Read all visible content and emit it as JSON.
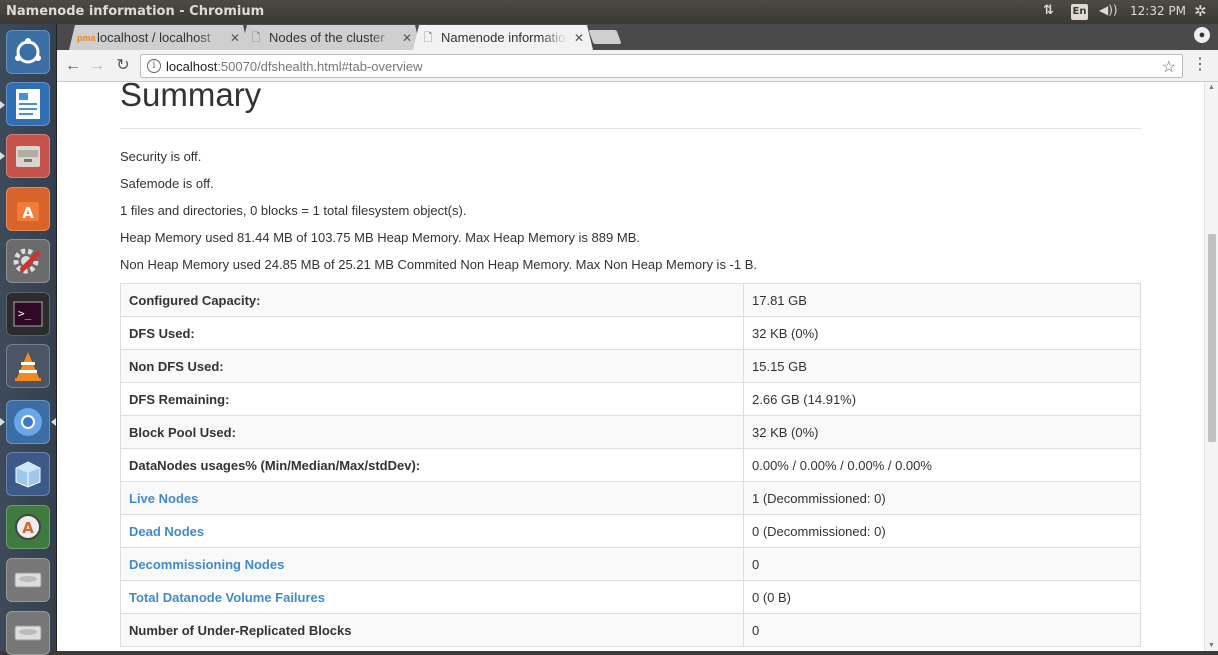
{
  "system": {
    "window_title": "Namenode information - Chromium",
    "lang": "En",
    "time": "12:32 PM"
  },
  "launcher": {
    "apps": [
      "ubuntu-dash-icon",
      "writer-icon",
      "files-icon",
      "software-center-icon",
      "system-settings-icon",
      "terminal-icon",
      "vlc-icon",
      "chromium-icon",
      "virtualbox-icon",
      "software-updater-icon",
      "drive-icon",
      "drive-icon",
      "drive-icon"
    ]
  },
  "browser": {
    "tabs": [
      {
        "title": "localhost / localhost",
        "active": false
      },
      {
        "title": "Nodes of the cluster",
        "active": false
      },
      {
        "title": "Namenode information",
        "active": true
      }
    ],
    "url_host": "localhost",
    "url_rest": ":50070/dfshealth.html#tab-overview"
  },
  "page": {
    "title": "Summary",
    "lines": [
      "Security is off.",
      "Safemode is off.",
      "1 files and directories, 0 blocks = 1 total filesystem object(s).",
      "Heap Memory used 81.44 MB of 103.75 MB Heap Memory. Max Heap Memory is 889 MB.",
      "Non Heap Memory used 24.85 MB of 25.21 MB Commited Non Heap Memory. Max Non Heap Memory is -1 B."
    ],
    "rows": [
      {
        "key": "Configured Capacity:",
        "value": "17.81 GB",
        "link": false
      },
      {
        "key": "DFS Used:",
        "value": "32 KB (0%)",
        "link": false
      },
      {
        "key": "Non DFS Used:",
        "value": "15.15 GB",
        "link": false
      },
      {
        "key": "DFS Remaining:",
        "value": "2.66 GB (14.91%)",
        "link": false
      },
      {
        "key": "Block Pool Used:",
        "value": "32 KB (0%)",
        "link": false
      },
      {
        "key": "DataNodes usages% (Min/Median/Max/stdDev):",
        "value": "0.00% / 0.00% / 0.00% / 0.00%",
        "link": false
      },
      {
        "key": "Live Nodes",
        "value": "1 (Decommissioned: 0)",
        "link": true
      },
      {
        "key": "Dead Nodes",
        "value": "0 (Decommissioned: 0)",
        "link": true
      },
      {
        "key": "Decommissioning Nodes",
        "value": "0",
        "link": true
      },
      {
        "key": "Total Datanode Volume Failures",
        "value": "0 (0 B)",
        "link": true
      },
      {
        "key": "Number of Under-Replicated Blocks",
        "value": "0",
        "link": false
      }
    ]
  },
  "colors": {
    "link": "#428bca",
    "text": "#333333"
  }
}
